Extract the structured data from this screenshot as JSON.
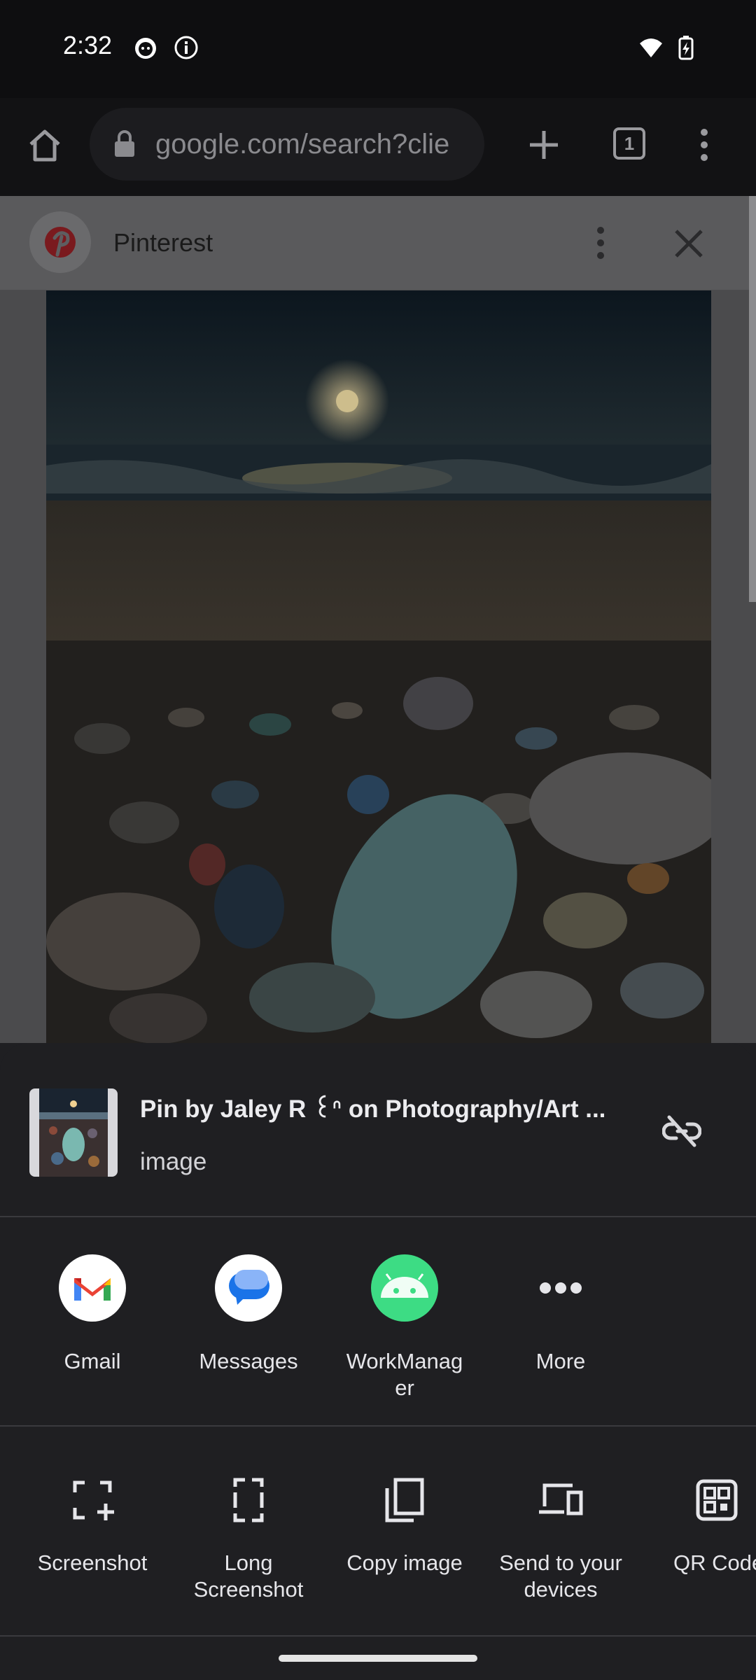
{
  "status_bar": {
    "time": "2:32"
  },
  "browser": {
    "url": "google.com/search?clie",
    "tab_count": "1"
  },
  "pin_viewer": {
    "source": "Pinterest"
  },
  "share_sheet": {
    "title": "Pin by Jaley R ꒰ᐢ on Photography/Art ...",
    "subtitle": "image",
    "apps": [
      {
        "label": "Gmail"
      },
      {
        "label": "Messages"
      },
      {
        "label": "WorkManag\ner"
      },
      {
        "label": "More"
      }
    ],
    "actions": [
      {
        "label": "Screenshot"
      },
      {
        "label": "Long\nScreenshot"
      },
      {
        "label": "Copy image"
      },
      {
        "label": "Send to your\ndevices"
      },
      {
        "label": "QR Code"
      }
    ]
  }
}
